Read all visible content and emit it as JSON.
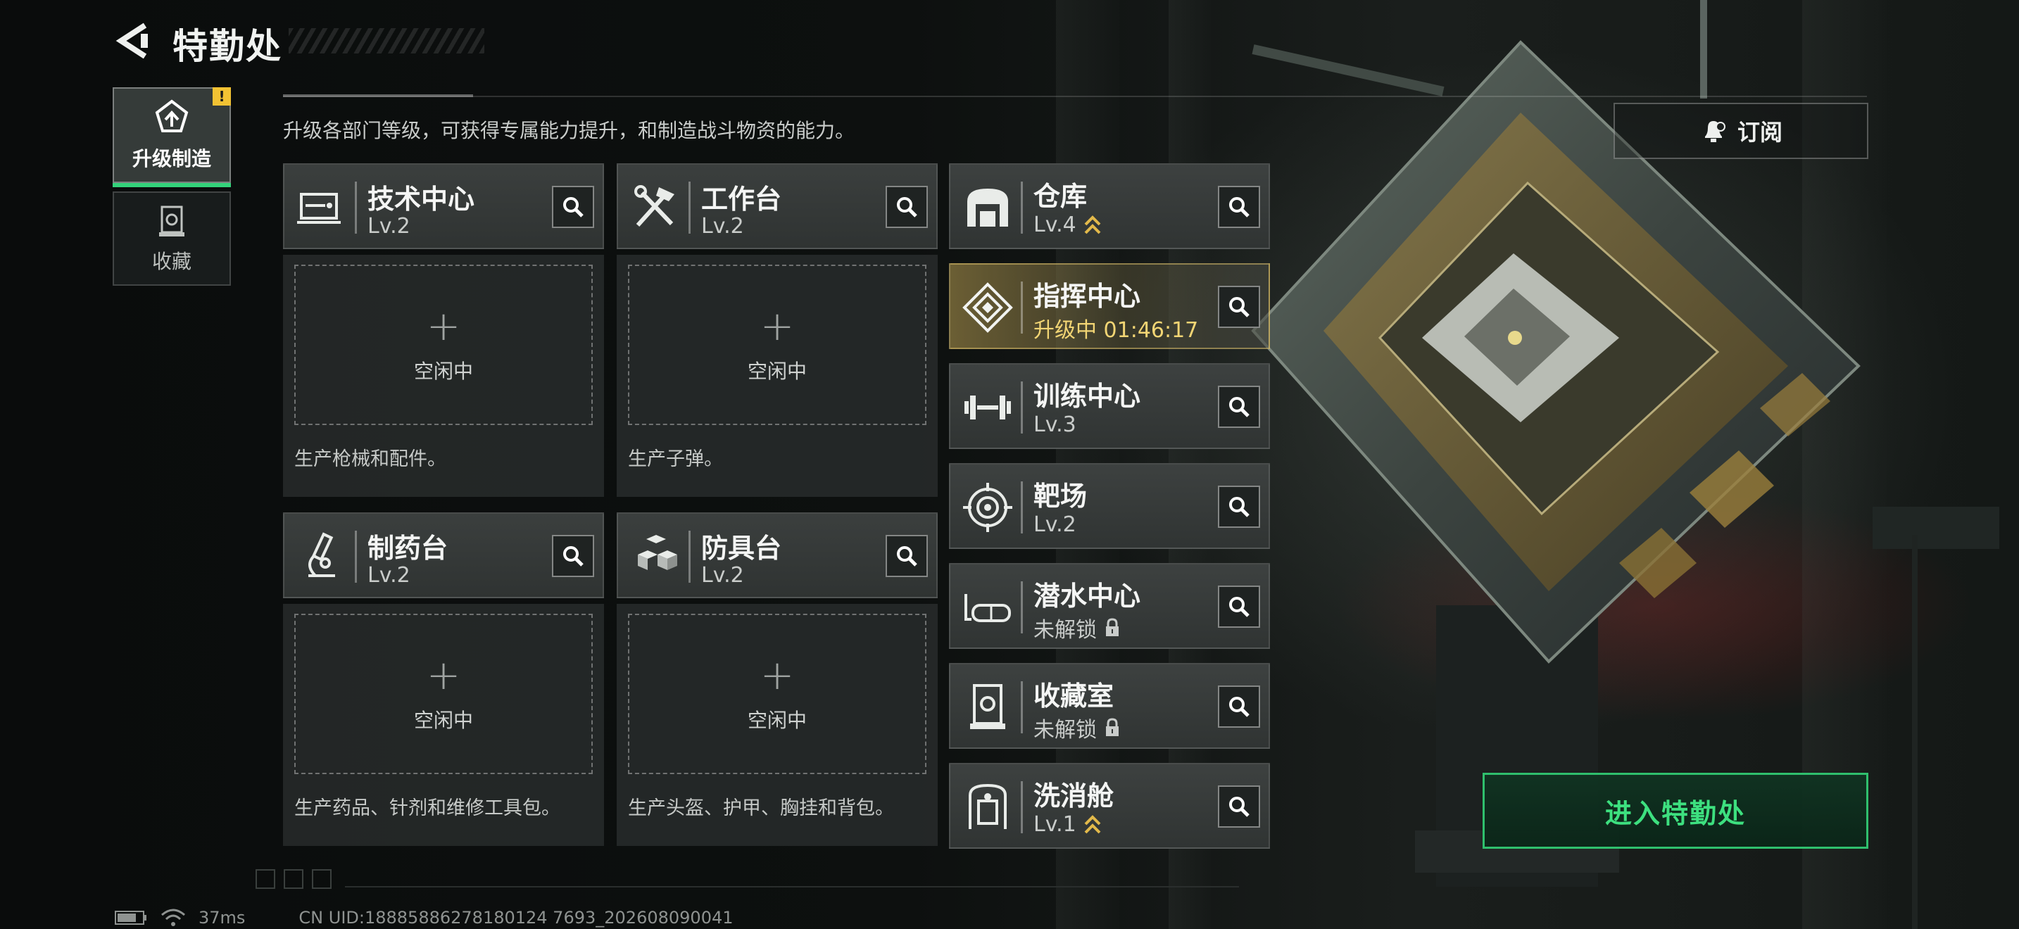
{
  "header": {
    "title": "特勤处"
  },
  "side_tabs": [
    {
      "label": "升级制造",
      "active": true,
      "alert": "!"
    },
    {
      "label": "收藏",
      "active": false
    }
  ],
  "description": "升级各部门等级，可获得专属能力提升，和制造战斗物资的能力。",
  "subscribe_label": "订阅",
  "production": [
    {
      "name": "技术中心",
      "level": "Lv.2",
      "slot_status": "空闲中",
      "desc": "生产枪械和配件。",
      "icon": "tech-center-icon"
    },
    {
      "name": "工作台",
      "level": "Lv.2",
      "slot_status": "空闲中",
      "desc": "生产子弹。",
      "icon": "workbench-icon"
    },
    {
      "name": "制药台",
      "level": "Lv.2",
      "slot_status": "空闲中",
      "desc": "生产药品、针剂和维修工具包。",
      "icon": "pharmacy-icon"
    },
    {
      "name": "防具台",
      "level": "Lv.2",
      "slot_status": "空闲中",
      "desc": "生产头盔、护甲、胸挂和背包。",
      "icon": "armor-bench-icon"
    }
  ],
  "facilities": [
    {
      "name": "仓库",
      "sub": "Lv.4",
      "marker": "rank",
      "icon": "warehouse-icon"
    },
    {
      "name": "指挥中心",
      "sub": "升级中 01:46:17",
      "marker": "upgrading",
      "icon": "command-center-icon"
    },
    {
      "name": "训练中心",
      "sub": "Lv.3",
      "marker": "none",
      "icon": "training-center-icon"
    },
    {
      "name": "靶场",
      "sub": "Lv.2",
      "marker": "none",
      "icon": "shooting-range-icon"
    },
    {
      "name": "潜水中心",
      "sub": "未解锁",
      "marker": "lock",
      "icon": "diving-center-icon"
    },
    {
      "name": "收藏室",
      "sub": "未解锁",
      "marker": "lock",
      "icon": "collection-room-icon"
    },
    {
      "name": "洗消舱",
      "sub": "Lv.1",
      "marker": "rank",
      "icon": "decontamination-icon"
    }
  ],
  "enter_label": "进入特勤处",
  "status_bar": {
    "ping": "37ms",
    "uid": "CN UID:18885886278180124 7693_202608090041"
  },
  "colors": {
    "accent_green": "#33d27a",
    "upgrade_gold": "#f2d574",
    "alert_yellow": "#f2c233"
  }
}
